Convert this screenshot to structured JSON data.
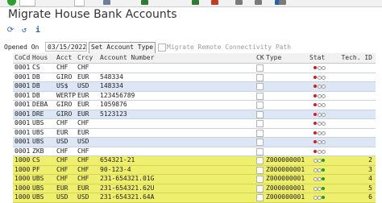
{
  "window": {
    "title": "Migrate House Bank Accounts"
  },
  "app_toolbar": {
    "icons": [
      "execute-icon",
      "refresh-icon",
      "info-icon"
    ]
  },
  "selection": {
    "opened_on_label": "Opened On",
    "opened_on_value": "03/15/2022",
    "set_account_type_label": "Set Account Type",
    "migrate_connectivity_label": "Migrate Remote Connectivity Path",
    "migrate_connectivity_checked": false
  },
  "table": {
    "headers": {
      "cocd": "CoCd",
      "hous": "Hous",
      "acct": "Acct",
      "crcy": "Crcy",
      "acnr": "Account Number",
      "ck": "CK",
      "type": "Type",
      "stat": "Stat",
      "tech": "Tech. ID"
    },
    "status_colors": {
      "red": "#d81b1b",
      "green": "#1aa31a",
      "off": "#ffffff"
    },
    "rows": [
      {
        "cocd": "0001",
        "hous": "CS",
        "acct": "CHF",
        "crcy": "CHF",
        "acnr": "",
        "type": "",
        "tech": "",
        "status": "red",
        "style": "white"
      },
      {
        "cocd": "0001",
        "hous": "DB",
        "acct": "GIRO",
        "crcy": "EUR",
        "acnr": "548334",
        "type": "",
        "tech": "",
        "status": "red",
        "style": "white"
      },
      {
        "cocd": "0001",
        "hous": "DB",
        "acct": "US$",
        "crcy": "USD",
        "acnr": "148334",
        "type": "",
        "tech": "",
        "status": "red",
        "style": "blue"
      },
      {
        "cocd": "0001",
        "hous": "DB",
        "acct": "WERTP",
        "crcy": "EUR",
        "acnr": "123456789",
        "type": "",
        "tech": "",
        "status": "red",
        "style": "white"
      },
      {
        "cocd": "0001",
        "hous": "DEBA",
        "acct": "GIRO",
        "crcy": "EUR",
        "acnr": "1059876",
        "type": "",
        "tech": "",
        "status": "red",
        "style": "white"
      },
      {
        "cocd": "0001",
        "hous": "DRE",
        "acct": "GIRO",
        "crcy": "EUR",
        "acnr": "5123123",
        "type": "",
        "tech": "",
        "status": "red",
        "style": "blue"
      },
      {
        "cocd": "0001",
        "hous": "UBS",
        "acct": "CHF",
        "crcy": "CHF",
        "acnr": "",
        "type": "",
        "tech": "",
        "status": "red",
        "style": "white"
      },
      {
        "cocd": "0001",
        "hous": "UBS",
        "acct": "EUR",
        "crcy": "EUR",
        "acnr": "",
        "type": "",
        "tech": "",
        "status": "red",
        "style": "white"
      },
      {
        "cocd": "0001",
        "hous": "UBS",
        "acct": "USD",
        "crcy": "USD",
        "acnr": "",
        "type": "",
        "tech": "",
        "status": "red",
        "style": "blue"
      },
      {
        "cocd": "0001",
        "hous": "ZKB",
        "acct": "CHF",
        "crcy": "CHF",
        "acnr": "",
        "type": "",
        "tech": "",
        "status": "red",
        "style": "white"
      },
      {
        "cocd": "1000",
        "hous": "CS",
        "acct": "CHF",
        "crcy": "CHF",
        "acnr": "654321-21",
        "type": "Z000000001",
        "tech": "2",
        "status": "green",
        "style": "yellow"
      },
      {
        "cocd": "1000",
        "hous": "PF",
        "acct": "CHF",
        "crcy": "CHF",
        "acnr": "90-123-4",
        "type": "Z000000001",
        "tech": "3",
        "status": "green",
        "style": "yellow"
      },
      {
        "cocd": "1000",
        "hous": "UBS",
        "acct": "CHF",
        "crcy": "CHF",
        "acnr": "231-654321.01G",
        "type": "Z000000001",
        "tech": "4",
        "status": "green",
        "style": "yellow"
      },
      {
        "cocd": "1000",
        "hous": "UBS",
        "acct": "EUR",
        "crcy": "EUR",
        "acnr": "231-654321.62U",
        "type": "Z000000001",
        "tech": "5",
        "status": "green",
        "style": "yellow"
      },
      {
        "cocd": "1000",
        "hous": "UBS",
        "acct": "USD",
        "crcy": "USD",
        "acnr": "231-654321.64A",
        "type": "Z000000001",
        "tech": "6",
        "status": "green",
        "style": "yellow"
      }
    ]
  }
}
